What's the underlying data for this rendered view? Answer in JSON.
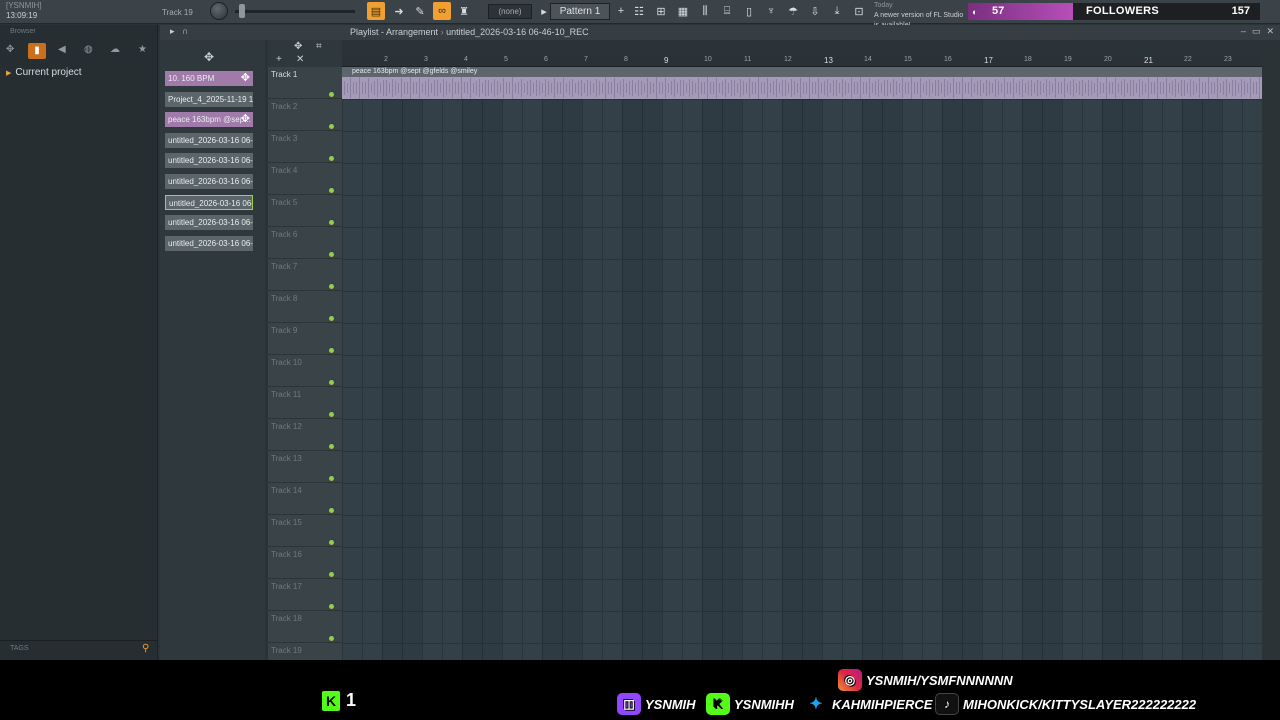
{
  "app": {
    "top_left": {
      "title": "[YSNMIH]",
      "time": "13:09:19"
    },
    "track_hint": "Track 19",
    "pattern_none": "(none)",
    "pattern": "Pattern 1",
    "news_today": "Today",
    "news_msg": "A newer version of FL Studio is available!"
  },
  "followers": {
    "current": "57",
    "label": "FOLLOWERS",
    "goal": "157",
    "progress_fraction": 0.36
  },
  "browser": {
    "title": "Browser",
    "item": "Current project",
    "tags_label": "TAGS"
  },
  "playlist": {
    "title": "Playlist - Arrangement",
    "breadcrumb": "untitled_2026-03-16 06-46-10_REC",
    "clip_label": "peace 163bpm @sept @gfelds @smiley",
    "ruler": [
      "2",
      "3",
      "4",
      "5",
      "6",
      "7",
      "8",
      "9",
      "10",
      "11",
      "12",
      "13",
      "14",
      "15",
      "16",
      "17",
      "18",
      "19",
      "20",
      "21",
      "22",
      "23"
    ],
    "tracks": [
      "Track 1",
      "Track 2",
      "Track 3",
      "Track 4",
      "Track 5",
      "Track 6",
      "Track 7",
      "Track 8",
      "Track 9",
      "Track 10",
      "Track 11",
      "Track 12",
      "Track 13",
      "Track 14",
      "Track 15",
      "Track 16",
      "Track 17",
      "Track 18",
      "Track 19"
    ]
  },
  "picker": {
    "items": [
      {
        "label": "10. 160 BPM",
        "kind": "pattern"
      },
      {
        "label": "Project_4_2025-11-19 1...",
        "kind": "audio"
      },
      {
        "label": "peace 163bpm @sep...",
        "kind": "pattern"
      },
      {
        "label": "untitled_2026-03-16 06-...",
        "kind": "audio"
      },
      {
        "label": "untitled_2026-03-16 06-...",
        "kind": "audio"
      },
      {
        "label": "untitled_2026-03-16 06-...",
        "kind": "audio"
      },
      {
        "label": "untitled_2026-03-16 06-...",
        "kind": "selected"
      },
      {
        "label": "untitled_2026-03-16 06-...",
        "kind": "audio"
      },
      {
        "label": "untitled_2026-03-16 06-...",
        "kind": "audio"
      }
    ]
  },
  "stream": {
    "kick_viewers": "1",
    "instagram": "YSNMIH/YSMFNNNNNN",
    "twitch": "YSNMIH",
    "kick": "YSNMIHH",
    "twitter": "KAHMIHPIERCE",
    "tiktok": "MIHONKICK/KITTYSLAYER222222222"
  },
  "colors": {
    "accent": "#f0a030",
    "pattern": "#a07aa8",
    "track_led": "#8fd14a",
    "kick": "#53fc18",
    "followers": "#b64fba"
  }
}
